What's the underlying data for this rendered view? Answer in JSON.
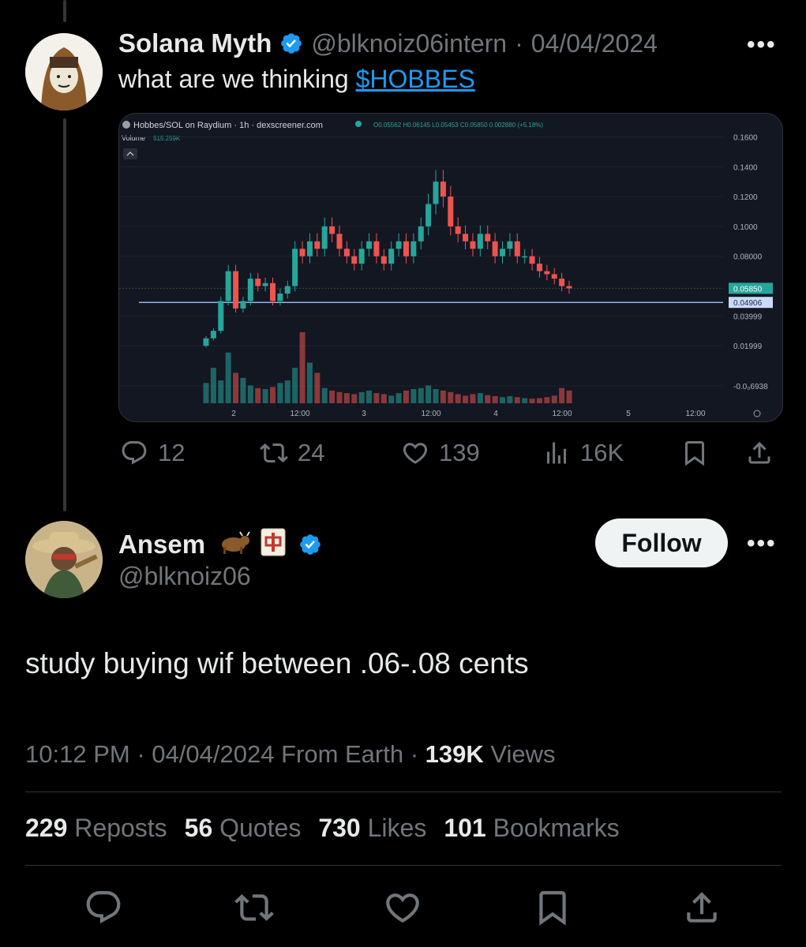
{
  "tweet1": {
    "name": "Solana Myth",
    "handle": "@blknoiz06intern",
    "separator": "·",
    "date": "04/04/2024",
    "text": "what are we thinking ",
    "cashtag": "$HOBBES",
    "actions": {
      "replies": "12",
      "reposts": "24",
      "likes": "139",
      "views": "16K"
    }
  },
  "chart_data": {
    "type": "candlestick",
    "title": "Hobbes/SOL on Raydium · 1h · dexscreener.com",
    "ohlc_label": "O0.05562 H0.06145 L0.05453 C0.05850 0.002880 (+5.18%)",
    "volume_label": "Volume",
    "volume_value": "515.259K",
    "y_ticks": [
      "0.1600",
      "0.1400",
      "0.1200",
      "0.1000",
      "0.08000",
      "0.05850",
      "0.04906",
      "0.03999",
      "0.01999",
      "-0.0₀6938"
    ],
    "x_ticks": [
      "2",
      "12:00",
      "3",
      "12:00",
      "4",
      "12:00",
      "5",
      "12:00"
    ],
    "ylim": [
      -0.0069,
      0.165
    ],
    "current_price": 0.0585,
    "price_line": 0.04906,
    "candles_close": [
      0.025,
      0.03,
      0.05,
      0.07,
      0.045,
      0.05,
      0.065,
      0.06,
      0.062,
      0.05,
      0.055,
      0.06,
      0.085,
      0.08,
      0.09,
      0.085,
      0.1,
      0.095,
      0.085,
      0.08,
      0.075,
      0.085,
      0.09,
      0.08,
      0.075,
      0.085,
      0.09,
      0.08,
      0.09,
      0.1,
      0.115,
      0.13,
      0.12,
      0.1,
      0.095,
      0.09,
      0.085,
      0.095,
      0.09,
      0.08,
      0.085,
      0.09,
      0.08,
      0.08,
      0.075,
      0.07,
      0.068,
      0.065,
      0.06,
      0.0585
    ],
    "volumes": [
      40,
      70,
      45,
      100,
      60,
      50,
      35,
      30,
      28,
      32,
      40,
      45,
      70,
      140,
      80,
      60,
      30,
      25,
      22,
      20,
      18,
      22,
      25,
      20,
      18,
      15,
      20,
      25,
      28,
      30,
      35,
      28,
      25,
      22,
      18,
      15,
      18,
      20,
      16,
      14,
      12,
      14,
      12,
      10,
      9,
      10,
      12,
      15,
      30,
      25
    ]
  },
  "tweet2": {
    "name": "Ansem",
    "emojis": "🐂🀄",
    "handle": "@blknoiz06",
    "follow_label": "Follow",
    "text": "study buying wif between .06-.08 cents",
    "time": "10:12 PM",
    "separator": "·",
    "date": "04/04/2024",
    "source": "From Earth",
    "views_num": "139K",
    "views_label": "Views",
    "stats": {
      "reposts_num": "229",
      "reposts_label": "Reposts",
      "quotes_num": "56",
      "quotes_label": "Quotes",
      "likes_num": "730",
      "likes_label": "Likes",
      "bookmarks_num": "101",
      "bookmarks_label": "Bookmarks"
    }
  },
  "more_label": "•••",
  "colors": {
    "accent": "#1d9bf0",
    "up": "#26a69a",
    "down": "#ef5350"
  }
}
